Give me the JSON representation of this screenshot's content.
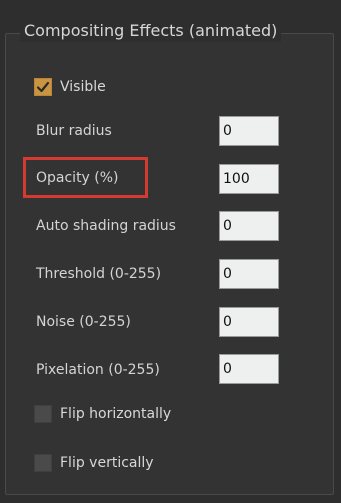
{
  "panel": {
    "title": "Compositing Effects (animated)"
  },
  "visible": {
    "label": "Visible",
    "checked": true
  },
  "fields": [
    {
      "label": "Blur radius",
      "value": "0"
    },
    {
      "label": "Opacity (%)",
      "value": "100"
    },
    {
      "label": "Auto shading radius",
      "value": "0"
    },
    {
      "label": "Threshold (0-255)",
      "value": "0"
    },
    {
      "label": "Noise (0-255)",
      "value": "0"
    },
    {
      "label": "Pixelation (0-255)",
      "value": "0"
    }
  ],
  "flip_horizontally": {
    "label": "Flip horizontally",
    "checked": false
  },
  "flip_vertically": {
    "label": "Flip vertically",
    "checked": false
  },
  "colors": {
    "highlight": "#d43a2f",
    "check_accent": "#c99540"
  },
  "icons": {
    "visible_check": "checkmark-icon"
  }
}
